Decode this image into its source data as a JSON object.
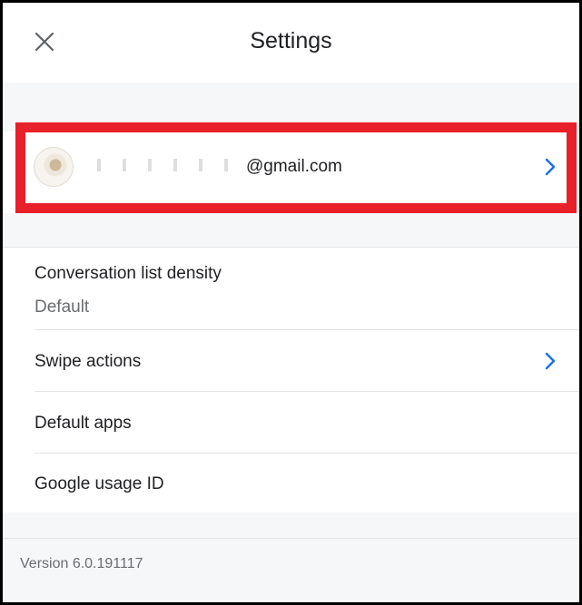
{
  "header": {
    "title": "Settings",
    "close_icon": "close-icon"
  },
  "account": {
    "email_suffix": "@gmail.com",
    "chevron_icon": "chevron-right-icon",
    "highlight_color": "#e8202a"
  },
  "settings": {
    "density_label": "Conversation list density",
    "density_value": "Default",
    "swipe_label": "Swipe actions",
    "default_apps_label": "Default apps",
    "usage_id_label": "Google usage ID"
  },
  "footer": {
    "version": "Version 6.0.191117"
  },
  "colors": {
    "accent": "#1a73e8",
    "highlight": "#e8202a",
    "background_gray": "#f6f7f8"
  }
}
